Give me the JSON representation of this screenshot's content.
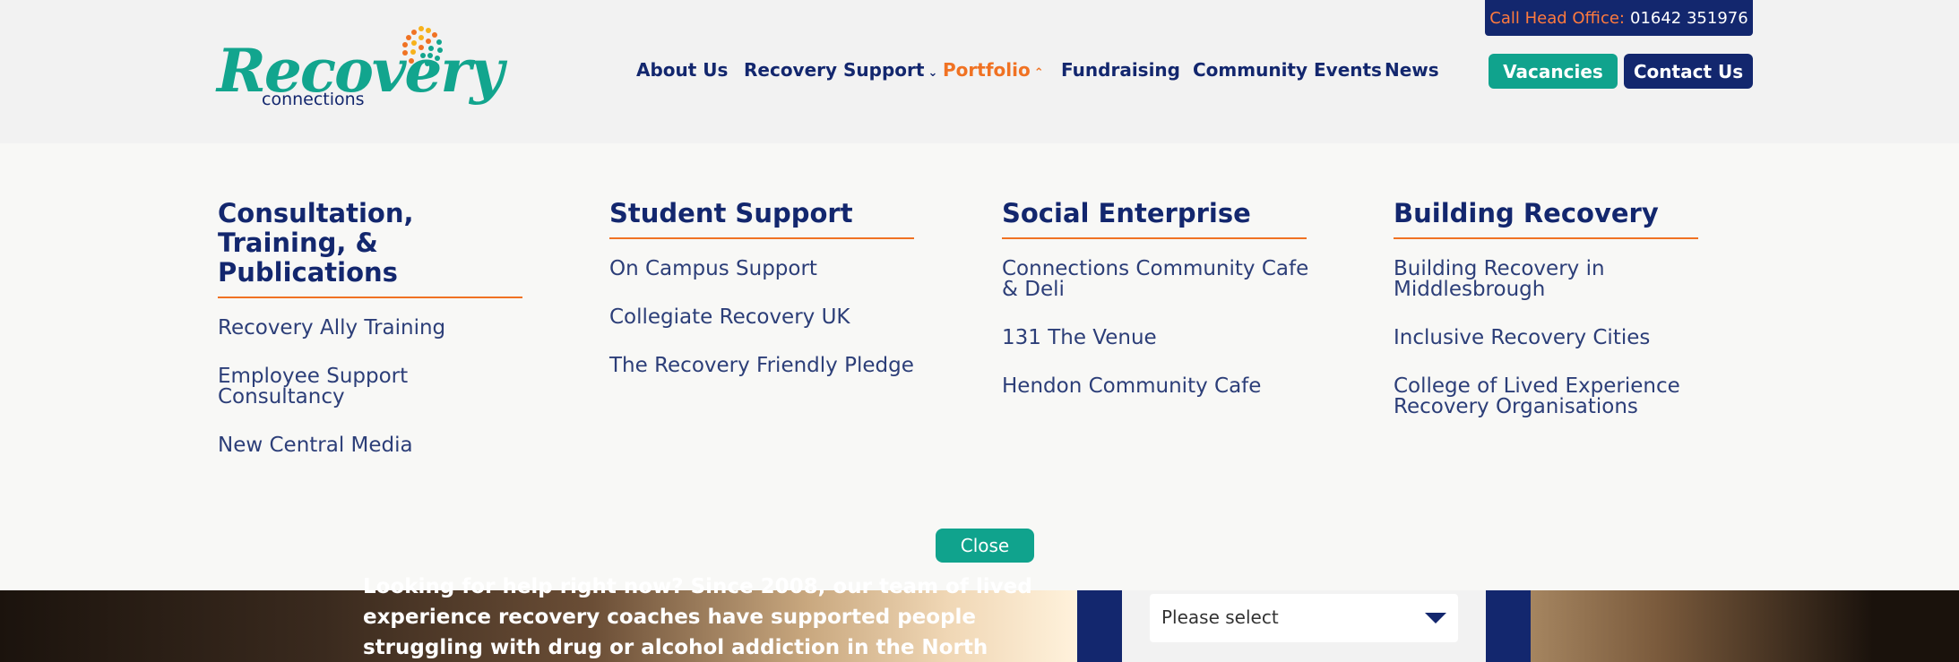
{
  "brand": {
    "logo_word": "Recovery",
    "logo_sub": "connections",
    "logo_color": "#12a58e",
    "navy": "#13276e",
    "orange": "#f07223"
  },
  "top_bar": {
    "call_label": "Call Head Office:",
    "call_number": "01642 351976"
  },
  "nav": {
    "about": "About Us",
    "recovery_support": "Recovery Support",
    "portfolio": "Portfolio",
    "fundraising": "Fundraising",
    "community_events": "Community Events",
    "news": "News",
    "vacancies": "Vacancies",
    "contact": "Contact Us",
    "chev_down": "⌄",
    "chev_up": "⌃"
  },
  "mega": {
    "columns": [
      {
        "heading_line1": "Consultation, Training, &",
        "heading_line2": "Publications",
        "links": [
          "Recovery Ally Training",
          "Employee Support Consultancy",
          "New Central Media"
        ]
      },
      {
        "heading_line1": "Student Support",
        "links": [
          "On Campus Support",
          "Collegiate Recovery UK",
          "The Recovery Friendly Pledge"
        ]
      },
      {
        "heading_line1": "Social Enterprise",
        "links": [
          "Connections Community Cafe & Deli",
          "131 The Venue",
          "Hendon Community Cafe"
        ]
      },
      {
        "heading_line1": "Building Recovery",
        "links": [
          "Building Recovery in Middlesbrough",
          "Inclusive Recovery Cities",
          "College of Lived Experience Recovery Organisations"
        ]
      }
    ],
    "close_label": "Close"
  },
  "hero": {
    "line1": "Looking for help right now? Since 2008, our team of lived",
    "line2": "experience recovery coaches have supported people",
    "line3": "struggling with drug or alcohol addiction in the North",
    "select_value": "Please select"
  }
}
